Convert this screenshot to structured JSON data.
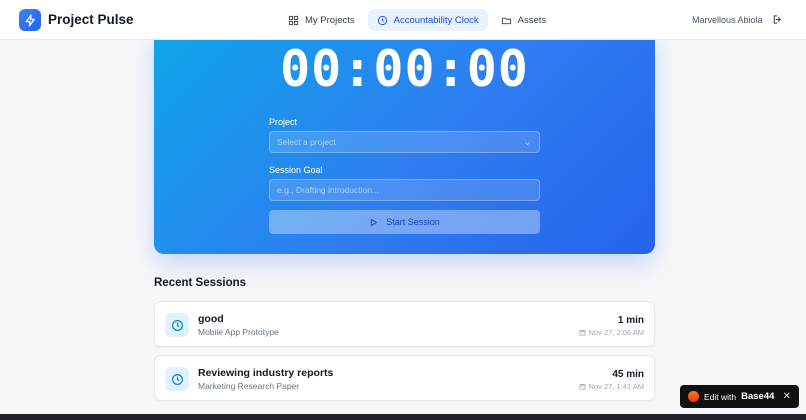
{
  "app": {
    "title": "Project Pulse",
    "user_name": "Marvellous Abiola"
  },
  "nav": {
    "items": [
      {
        "label": "My Projects",
        "icon": "grid-icon",
        "active": false
      },
      {
        "label": "Accountability Clock",
        "icon": "clock-icon",
        "active": true
      },
      {
        "label": "Assets",
        "icon": "folder-icon",
        "active": false
      }
    ]
  },
  "timer": {
    "display": "00:00:00",
    "project_label": "Project",
    "project_placeholder": "Select a project",
    "goal_label": "Session Goal",
    "goal_placeholder": "e.g., Drafting introduction...",
    "start_label": "Start Session"
  },
  "recent": {
    "title": "Recent Sessions",
    "sessions": [
      {
        "title": "good",
        "project": "Mobile App Prototype",
        "duration": "1 min",
        "date": "Nov 27, 2:06 AM"
      },
      {
        "title": "Reviewing industry reports",
        "project": "Marketing Research Paper",
        "duration": "45 min",
        "date": "Nov 27, 1:41 AM"
      }
    ]
  },
  "badge": {
    "prefix": "Edit with",
    "brand": "Base44"
  },
  "colors": {
    "accent": "#2563eb",
    "gradient_start": "#0ea5e9",
    "gradient_end": "#2563eb"
  }
}
